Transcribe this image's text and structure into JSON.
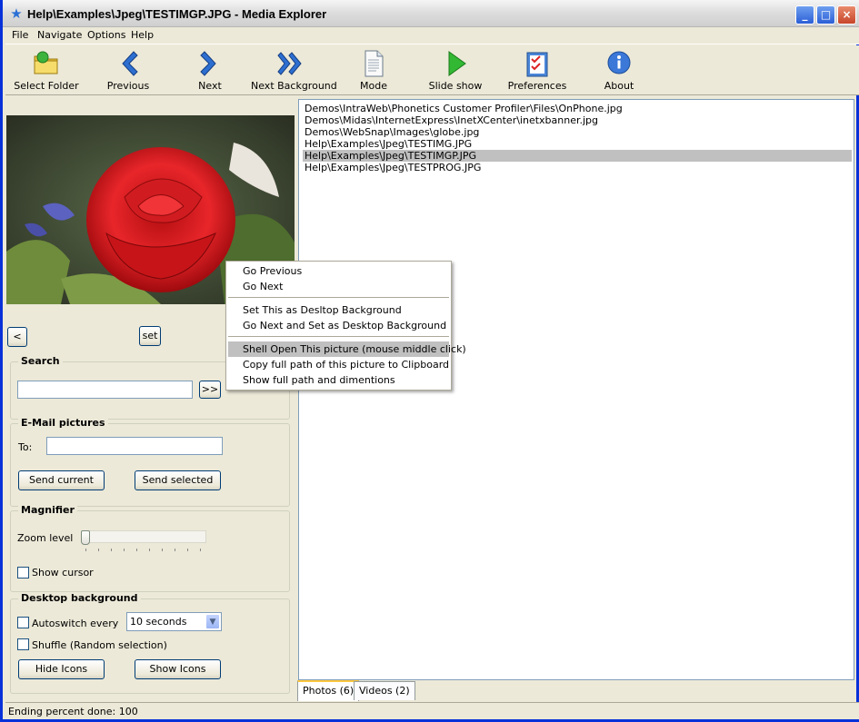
{
  "window": {
    "title": "Help\\Examples\\Jpeg\\TESTIMGP.JPG - Media Explorer"
  },
  "menu": [
    "File",
    "Navigate",
    "Options",
    "Help"
  ],
  "toolbar": {
    "select_folder": "Select Folder",
    "previous": "Previous",
    "next": "Next",
    "next_background": "Next Background",
    "mode": "Mode",
    "slide_show": "Slide show",
    "preferences": "Preferences",
    "about": "About"
  },
  "left": {
    "prev_btn": "<",
    "set_btn": "set",
    "search": {
      "title": "Search",
      "value": "",
      "go": ">>"
    },
    "email": {
      "title": "E-Mail pictures",
      "to_label": "To:",
      "to_value": "",
      "send_current": "Send current",
      "send_selected": "Send selected"
    },
    "magnifier": {
      "title": "Magnifier",
      "zoom_label": "Zoom level",
      "zoom_level": 0,
      "show_cursor": "Show cursor"
    },
    "desktop": {
      "title": "Desktop background",
      "autoswitch": "Autoswitch every",
      "interval": "10 seconds",
      "shuffle": "Shuffle (Random selection)",
      "hide_icons": "Hide Icons",
      "show_icons": "Show Icons"
    }
  },
  "files": [
    "Demos\\IntraWeb\\Phonetics Customer Profiler\\Files\\OnPhone.jpg",
    "Demos\\Midas\\InternetExpress\\InetXCenter\\inetxbanner.jpg",
    "Demos\\WebSnap\\Images\\globe.jpg",
    "Help\\Examples\\Jpeg\\TESTIMG.JPG",
    "Help\\Examples\\Jpeg\\TESTIMGP.JPG",
    "Help\\Examples\\Jpeg\\TESTPROG.JPG"
  ],
  "selected_file": "Help\\Examples\\Jpeg\\TESTIMGP.JPG",
  "tabs": [
    "Photos (6)",
    "Videos (2)"
  ],
  "status": "Ending percent done: 100",
  "context_menu": {
    "go_previous": "Go Previous",
    "go_next": "Go Next",
    "set_background": "Set This as Desltop Background",
    "next_and_set": "Go Next and Set as Desktop Background",
    "shell_open": "Shell Open This picture (mouse middle click)",
    "copy_path": "Copy full path of this picture to Clipboard",
    "show_path": "Show full path and dimentions"
  },
  "colors": {
    "accent": "#0831d9",
    "selection": "#c0c0c0",
    "tab_highlight": "#ffc83c"
  }
}
